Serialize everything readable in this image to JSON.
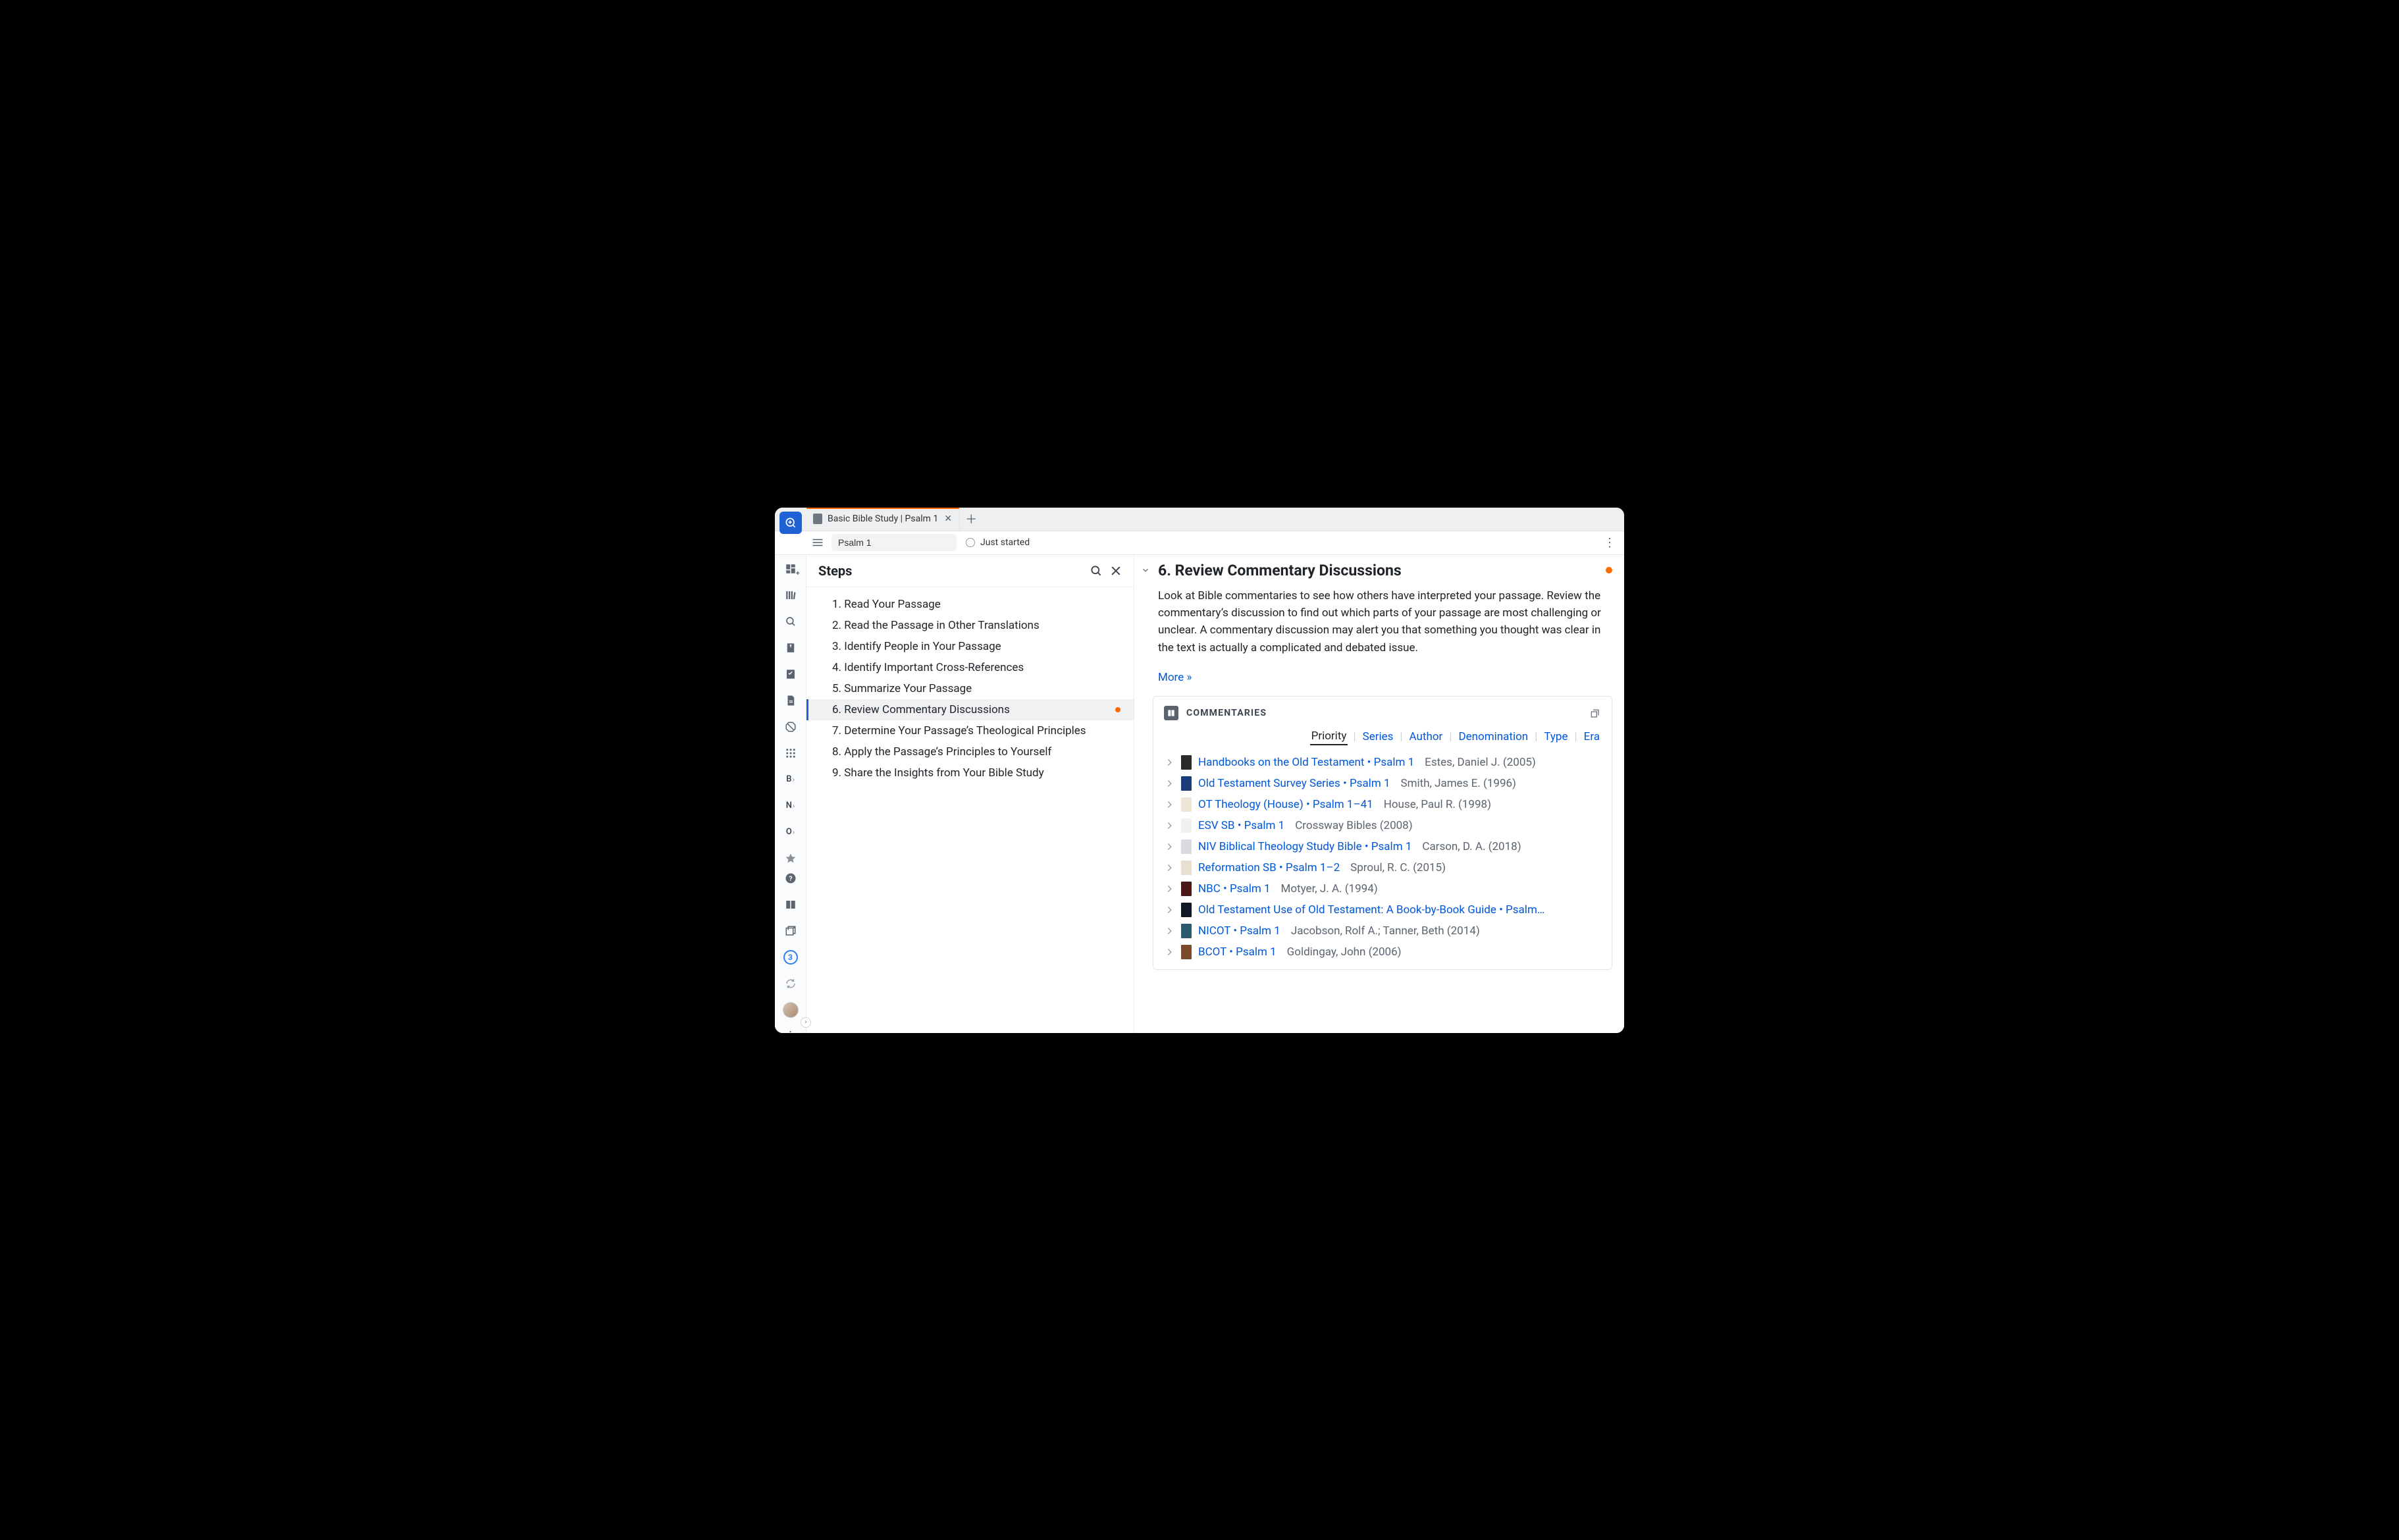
{
  "tab": {
    "title": "Basic Bible Study | Psalm 1"
  },
  "toolbar": {
    "passage": "Psalm 1",
    "status": "Just started"
  },
  "sidebar": {
    "letters": [
      "B",
      "N",
      "O"
    ],
    "sync_count": "3"
  },
  "steps": {
    "header": "Steps",
    "items": [
      {
        "n": "1",
        "label": "Read Your Passage"
      },
      {
        "n": "2",
        "label": "Read the Passage in Other Translations"
      },
      {
        "n": "3",
        "label": "Identify People in Your Passage"
      },
      {
        "n": "4",
        "label": "Identify Important Cross-References"
      },
      {
        "n": "5",
        "label": "Summarize Your Passage"
      },
      {
        "n": "6",
        "label": "Review Commentary Discussions",
        "active": true,
        "dot": true
      },
      {
        "n": "7",
        "label": "Determine Your Passage’s Theological Principles"
      },
      {
        "n": "8",
        "label": "Apply the Passage’s Principles to Yourself"
      },
      {
        "n": "9",
        "label": "Share the Insights from Your Bible Study"
      }
    ]
  },
  "detail": {
    "title": "6. Review Commentary Discussions",
    "description": "Look at Bible commentaries to see how others have interpreted your passage. Review the commentary’s discussion to find out which parts of your passage are most challenging or unclear. A commentary discussion may alert you that something you thought was clear in the text is actually a complicated and debated issue.",
    "more": "More »"
  },
  "commentaries": {
    "heading": "COMMENTARIES",
    "sort_tabs": [
      "Priority",
      "Series",
      "Author",
      "Denomination",
      "Type",
      "Era"
    ],
    "sort_active": "Priority",
    "entries": [
      {
        "title": "Handbooks on the Old Testament • Psalm 1",
        "meta": "Estes, Daniel J. (2005)",
        "thumb": "#2b2b2b"
      },
      {
        "title": "Old Testament Survey Series • Psalm 1",
        "meta": "Smith, James E. (1996)",
        "thumb": "#1a3b7a"
      },
      {
        "title": "OT Theology (House) • Psalm 1–41",
        "meta": "House, Paul R. (1998)",
        "thumb": "#efe6d8"
      },
      {
        "title": "ESV SB • Psalm 1",
        "meta": "Crossway Bibles (2008)",
        "thumb": "#f2efef"
      },
      {
        "title": "NIV Biblical Theology Study Bible • Psalm 1",
        "meta": "Carson, D. A. (2018)",
        "thumb": "#d9dbe0"
      },
      {
        "title": "Reformation SB • Psalm 1–2",
        "meta": "Sproul, R. C. (2015)",
        "thumb": "#eaddd2"
      },
      {
        "title": "NBC • Psalm 1",
        "meta": "Motyer, J. A. (1994)",
        "thumb": "#4a1616"
      },
      {
        "title": "Old Testament Use of Old Testament: A Book-by-Book Guide • Psalm…",
        "meta": "",
        "thumb": "#101826"
      },
      {
        "title": "NICOT • Psalm 1",
        "meta": "Jacobson, Rolf A.; Tanner, Beth (2014)",
        "thumb": "#2a5a6e"
      },
      {
        "title": "BCOT • Psalm 1",
        "meta": "Goldingay, John (2006)",
        "thumb": "#7a4a2a"
      }
    ]
  }
}
